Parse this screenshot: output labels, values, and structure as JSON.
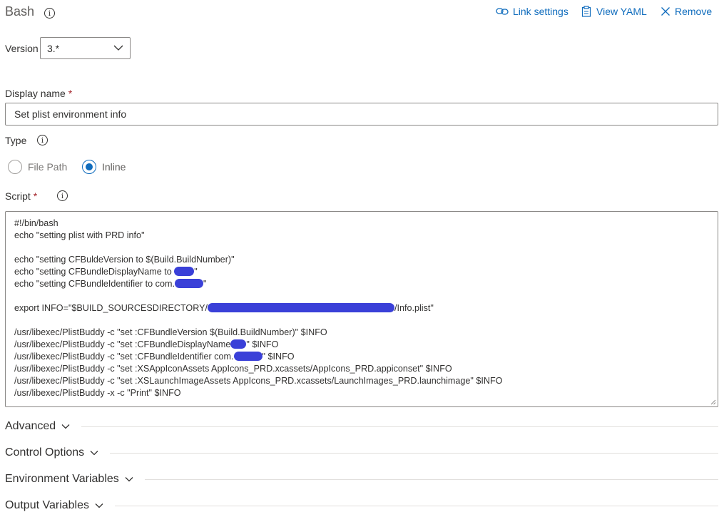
{
  "task": {
    "title": "Bash",
    "links": {
      "link_settings": "Link settings",
      "view_yaml": "View YAML",
      "remove": "Remove"
    }
  },
  "version": {
    "label": "Version",
    "value": "3.*"
  },
  "display_name": {
    "label": "Display name",
    "required": "*",
    "value": "Set plist environment info"
  },
  "type": {
    "label": "Type",
    "options": [
      "File Path",
      "Inline"
    ],
    "selected": "Inline"
  },
  "script": {
    "label": "Script",
    "required": "*",
    "lines": [
      "#!/bin/bash",
      "echo \"setting plist with PRD info\"",
      "",
      "echo \"setting CFBuldeVersion to $(Build.BuildNumber)\"",
      "echo \"setting CFBundleDisplayName to",
      "echo \"setting CFBundleIdentifier to com.",
      "",
      "export INFO=\"$BUILD_SOURCESDIRECTORY/",
      "",
      "/usr/libexec/PlistBuddy -c \"set :CFBundleVersion $(Build.BuildNumber)\" $INFO",
      "/usr/libexec/PlistBuddy -c \"set :CFBundleDisplayName",
      "/usr/libexec/PlistBuddy -c \"set :CFBundleIdentifier com.",
      "/usr/libexec/PlistBuddy -c \"set :XSAppIconAssets AppIcons_PRD.xcassets/AppIcons_PRD.appiconset\" $INFO",
      "/usr/libexec/PlistBuddy -c \"set :XSLaunchImageAssets AppIcons_PRD.xcassets/LaunchImages_PRD.launchimage\" $INFO",
      "/usr/libexec/PlistBuddy -x -c \"Print\" $INFO"
    ],
    "line_tails": {
      "display_name_echo": "\"",
      "identifier_echo": "\"",
      "export_info": "/Info.plist\"",
      "display_name_set": "\" $INFO",
      "identifier_set": "\" $INFO"
    }
  },
  "sections": {
    "advanced": "Advanced",
    "control_options": "Control Options",
    "environment_variables": "Environment Variables",
    "output_variables": "Output Variables"
  },
  "colors": {
    "accent": "#0f6cbd",
    "redaction": "#3a40d8",
    "required": "#a4262c"
  }
}
